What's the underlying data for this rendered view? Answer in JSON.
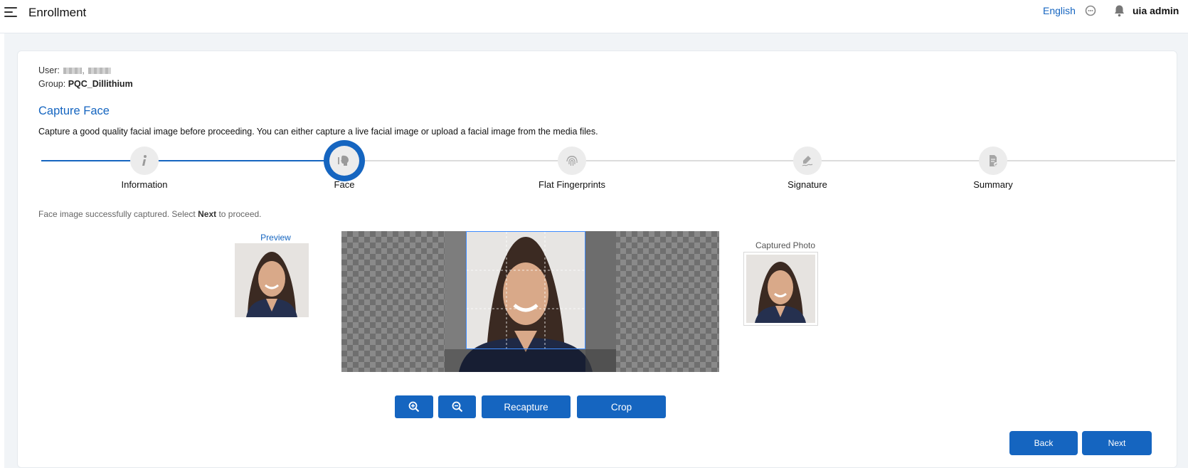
{
  "header": {
    "title": "Enrollment",
    "language": "English",
    "user_name": "uia admin"
  },
  "enrollment": {
    "user_label": "User:",
    "group_label": "Group:",
    "group_value": "PQC_Dillithium"
  },
  "section": {
    "title": "Capture Face",
    "description": "Capture a good quality facial image before proceeding. You can either capture a live facial image or upload a facial image from the media files."
  },
  "steps": [
    {
      "label": "Information",
      "icon": "info-icon",
      "state": "complete"
    },
    {
      "label": "Face",
      "icon": "face-icon",
      "state": "active"
    },
    {
      "label": "Flat Fingerprints",
      "icon": "fingerprint-icon",
      "state": "pending"
    },
    {
      "label": "Signature",
      "icon": "signature-icon",
      "state": "pending"
    },
    {
      "label": "Summary",
      "icon": "summary-icon",
      "state": "pending"
    }
  ],
  "status": {
    "prefix": "Face image successfully captured. Select ",
    "keyword": "Next",
    "suffix": " to proceed."
  },
  "preview": {
    "label": "Preview"
  },
  "captured": {
    "label": "Captured Photo"
  },
  "crop_toolbar": {
    "recapture_label": "Recapture",
    "crop_label": "Crop"
  },
  "nav": {
    "back_label": "Back",
    "next_label": "Next"
  },
  "colors": {
    "accent": "#1565c0",
    "step_inactive": "#ececec",
    "page_background": "#f1f4f7"
  }
}
